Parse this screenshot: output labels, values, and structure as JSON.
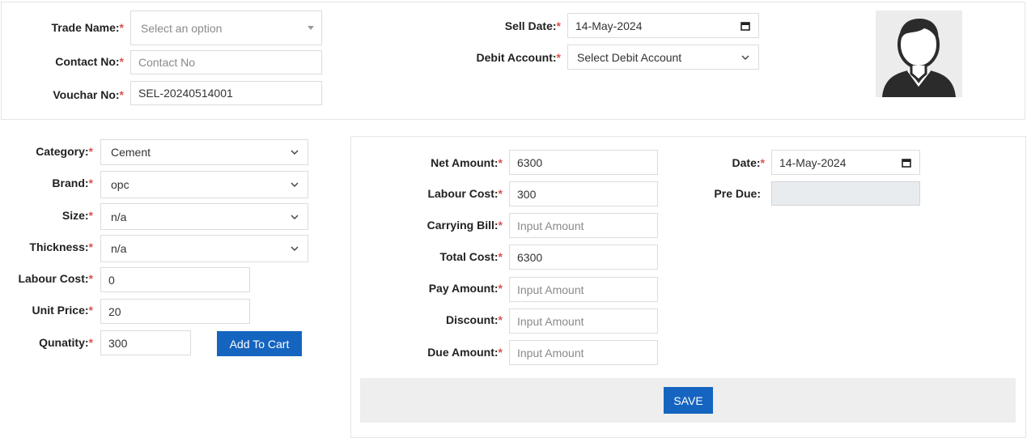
{
  "header_form": {
    "trade_name": {
      "label": "Trade Name:",
      "required": "*",
      "value": "Select an option"
    },
    "contact_no": {
      "label": "Contact No:",
      "required": "*",
      "placeholder": "Contact No"
    },
    "vouchar_no": {
      "label": "Vouchar No:",
      "required": "*",
      "value": "SEL-20240514001"
    },
    "sell_date": {
      "label": "Sell Date:",
      "required": "*",
      "value": "14-May-2024"
    },
    "debit_account": {
      "label": "Debit Account:",
      "required": "*",
      "value": "Select Debit Account"
    },
    "avatar_icon": "user-avatar-icon"
  },
  "product_form": {
    "category": {
      "label": "Category:",
      "required": "*",
      "value": "Cement"
    },
    "brand": {
      "label": "Brand:",
      "required": "*",
      "value": "opc"
    },
    "size": {
      "label": "Size:",
      "required": "*",
      "value": "n/a"
    },
    "thickness": {
      "label": "Thickness:",
      "required": "*",
      "value": "n/a"
    },
    "labour_cost": {
      "label": "Labour Cost:",
      "required": "*",
      "value": "0"
    },
    "unit_price": {
      "label": "Unit Price:",
      "required": "*",
      "value": "20"
    },
    "quantity": {
      "label": "Qunatity:",
      "required": "*",
      "value": "300"
    },
    "add_to_cart_label": "Add To Cart"
  },
  "payment_form": {
    "net_amount": {
      "label": "Net Amount:",
      "required": "*",
      "value": "6300"
    },
    "labour_cost": {
      "label": "Labour Cost:",
      "required": "*",
      "value": "300"
    },
    "carrying_bill": {
      "label": "Carrying Bill:",
      "required": "*",
      "placeholder": "Input Amount"
    },
    "total_cost": {
      "label": "Total Cost:",
      "required": "*",
      "value": "6300"
    },
    "pay_amount": {
      "label": "Pay Amount:",
      "required": "*",
      "placeholder": "Input Amount"
    },
    "discount": {
      "label": "Discount:",
      "required": "*",
      "placeholder": "Input Amount"
    },
    "due_amount": {
      "label": "Due Amount:",
      "required": "*",
      "placeholder": "Input Amount"
    },
    "date": {
      "label": "Date:",
      "required": "*",
      "value": "14-May-2024"
    },
    "pre_due": {
      "label": "Pre Due:",
      "value": ""
    },
    "save_label": "SAVE"
  },
  "colors": {
    "primary_button": "#1565c0",
    "required_mark": "#d9534f",
    "disabled_field": "#e9ecef"
  }
}
